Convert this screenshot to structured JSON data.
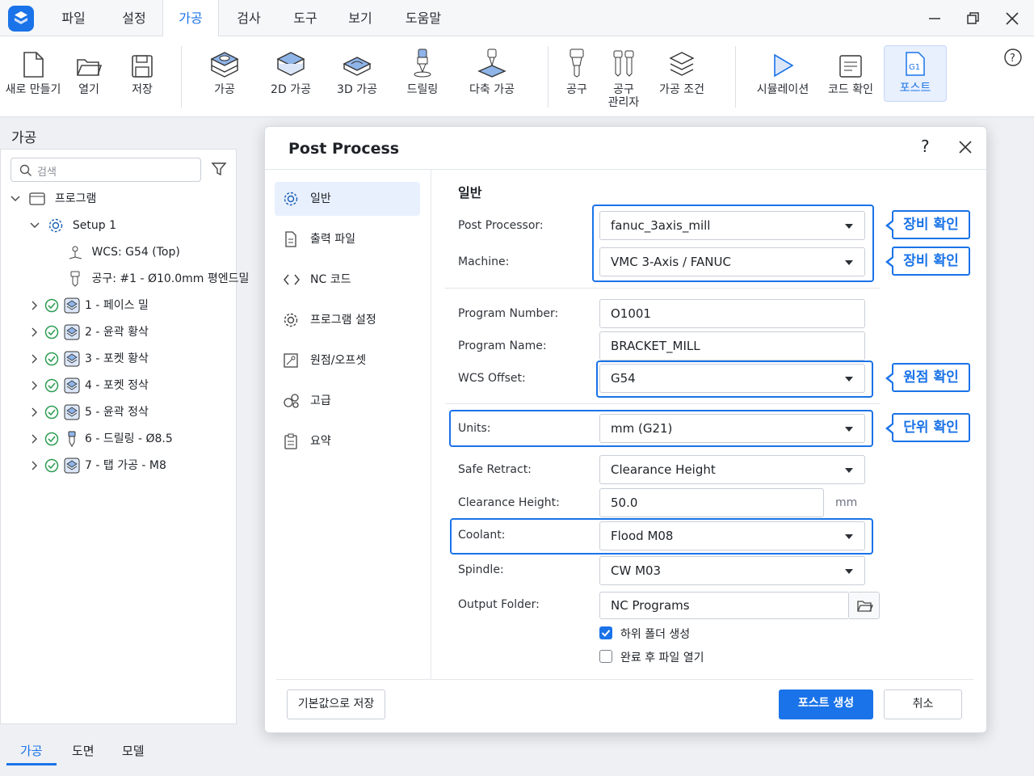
{
  "menubar": {
    "items": [
      "파일",
      "설정",
      "가공",
      "검사",
      "도구",
      "보기",
      "도움말"
    ],
    "active": "가공"
  },
  "ribbon": {
    "new": "새로 만들기",
    "open": "열기",
    "save": "저장",
    "machining": "가공",
    "machining_2d": "2D 가공",
    "machining_3d": "3D 가공",
    "drilling": "드릴링",
    "multiaxis": "다축 가공",
    "tool": "공구",
    "tool_manager_1": "공구",
    "tool_manager_2": "관리자",
    "conditions": "가공 조건",
    "simulation": "시뮬레이션",
    "code_check": "코드 확인",
    "post": "포스트"
  },
  "left_panel": {
    "title": "가공",
    "search_placeholder": "검색",
    "tree": {
      "program": "프로그램",
      "setup": "Setup 1",
      "wcs": "WCS: G54 (Top)",
      "tool": "공구: #1 - Ø10.0mm 평엔드밀",
      "ops": [
        "1 - 페이스 밀",
        "2 - 윤곽 황삭",
        "3 - 포켓 황삭",
        "4 - 포켓 정삭",
        "5 - 윤곽 정삭",
        "6 - 드릴링 - Ø8.5",
        "7 - 탭 가공 - M8"
      ]
    },
    "bottom_tabs": [
      "가공",
      "도면",
      "모델"
    ]
  },
  "dialog": {
    "title": "Post Process",
    "help": "?",
    "nav": [
      "일반",
      "출력 파일",
      "NC 코드",
      "프로그램 설정",
      "원점/오프셋",
      "고급",
      "요약"
    ],
    "section_title": "일반",
    "fields": {
      "post_processor_label": "Post Processor:",
      "post_processor_value": "fanuc_3axis_mill",
      "machine_label": "Machine:",
      "machine_value": "VMC 3-Axis / FANUC",
      "program_number_label": "Program Number:",
      "program_number_value": "O1001",
      "program_name_label": "Program Name:",
      "program_name_value": "BRACKET_MILL",
      "wcs_offset_label": "WCS Offset:",
      "wcs_offset_value": "G54",
      "units_label": "Units:",
      "units_value": "mm (G21)",
      "safe_retract_label": "Safe Retract:",
      "safe_retract_value": "Clearance Height",
      "clearance_height_label": "Clearance Height:",
      "clearance_height_value": "50.0",
      "clearance_height_unit": "mm",
      "coolant_label": "Coolant:",
      "coolant_value": "Flood M08",
      "spindle_label": "Spindle:",
      "spindle_value": "CW M03",
      "output_folder_label": "Output Folder:",
      "output_folder_value": "NC Programs"
    },
    "checkboxes": {
      "create_subfolder": "하위 폴더 생성",
      "create_subfolder_checked": true,
      "open_after": "완료 후 파일 열기",
      "open_after_checked": false
    },
    "callouts": {
      "equipment_1": "장비 확인",
      "equipment_2": "장비 확인",
      "origin": "원점 확인",
      "units": "단위 확인"
    },
    "buttons": {
      "save_default": "기본값으로 저장",
      "generate_post": "포스트 생성",
      "cancel": "취소"
    }
  },
  "colors": {
    "accent": "#1a73e8",
    "check_green": "#2e9e55"
  }
}
